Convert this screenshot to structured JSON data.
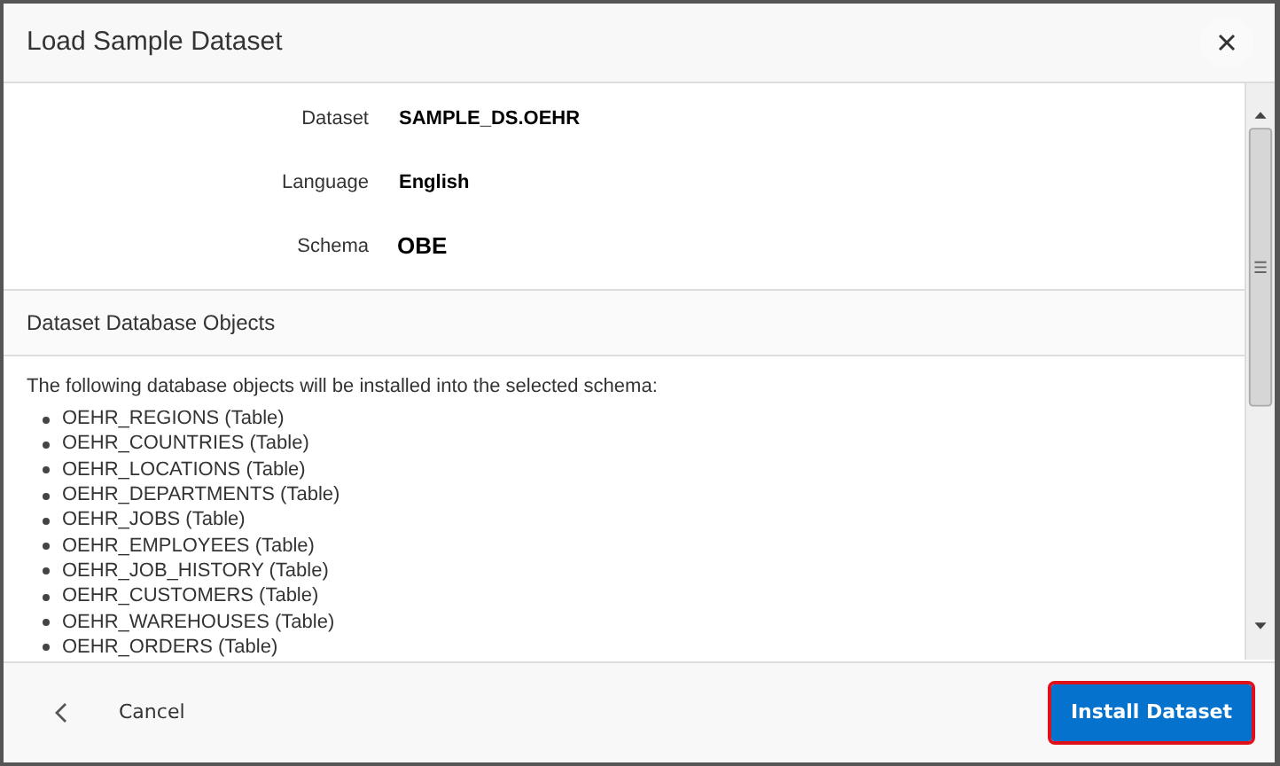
{
  "dialog": {
    "title": "Load Sample Dataset"
  },
  "fields": [
    {
      "label": "Dataset",
      "value": "SAMPLE_DS.OEHR",
      "kind": "text"
    },
    {
      "label": "Language",
      "value": "English",
      "kind": "text"
    },
    {
      "label": "Schema",
      "value": "OBE",
      "kind": "large"
    }
  ],
  "section": {
    "title": "Dataset Database Objects",
    "intro": "The following database objects will be installed into the selected schema:",
    "objects": [
      "OEHR_REGIONS (Table)",
      "OEHR_COUNTRIES (Table)",
      "OEHR_LOCATIONS (Table)",
      "OEHR_DEPARTMENTS (Table)",
      "OEHR_JOBS (Table)",
      "OEHR_EMPLOYEES (Table)",
      "OEHR_JOB_HISTORY (Table)",
      "OEHR_CUSTOMERS (Table)",
      "OEHR_WAREHOUSES (Table)",
      "OEHR_ORDERS (Table)"
    ]
  },
  "footer": {
    "cancel": "Cancel",
    "install": "Install Dataset",
    "install_highlighted": true
  }
}
